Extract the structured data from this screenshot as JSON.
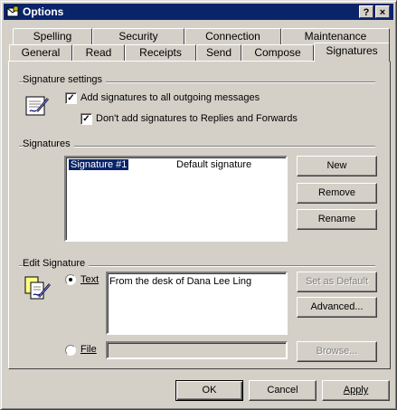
{
  "window": {
    "title": "Options",
    "help_glyph": "?",
    "close_glyph": "×"
  },
  "tabs_back": [
    "Spelling",
    "Security",
    "Connection",
    "Maintenance"
  ],
  "tabs_front": [
    "General",
    "Read",
    "Receipts",
    "Send",
    "Compose",
    "Signatures"
  ],
  "active_tab": "Signatures",
  "signature_settings": {
    "group_label": "Signature settings",
    "add_all": {
      "label": "Add signatures to all outgoing messages",
      "checked": true
    },
    "no_replies": {
      "label": "Don't add signatures to Replies and Forwards",
      "checked": true
    }
  },
  "signatures": {
    "group_label": "Signatures",
    "items": [
      {
        "name": "Signature #1",
        "note": "Default signature",
        "selected": true
      }
    ],
    "buttons": {
      "new": "New",
      "remove": "Remove",
      "rename": "Rename"
    }
  },
  "edit_signature": {
    "group_label": "Edit Signature",
    "text_option": {
      "label": "Text",
      "selected": true
    },
    "text_value": "From the desk of Dana Lee Ling",
    "file_option": {
      "label": "File",
      "selected": false
    },
    "file_value": "",
    "buttons": {
      "set_default": "Set as Default",
      "advanced": "Advanced...",
      "browse": "Browse..."
    }
  },
  "footer": {
    "ok": "OK",
    "cancel": "Cancel",
    "apply": "Apply"
  },
  "colors": {
    "titlebar": "#0a246a",
    "face": "#d4d0c8",
    "selection": "#0a246a"
  }
}
